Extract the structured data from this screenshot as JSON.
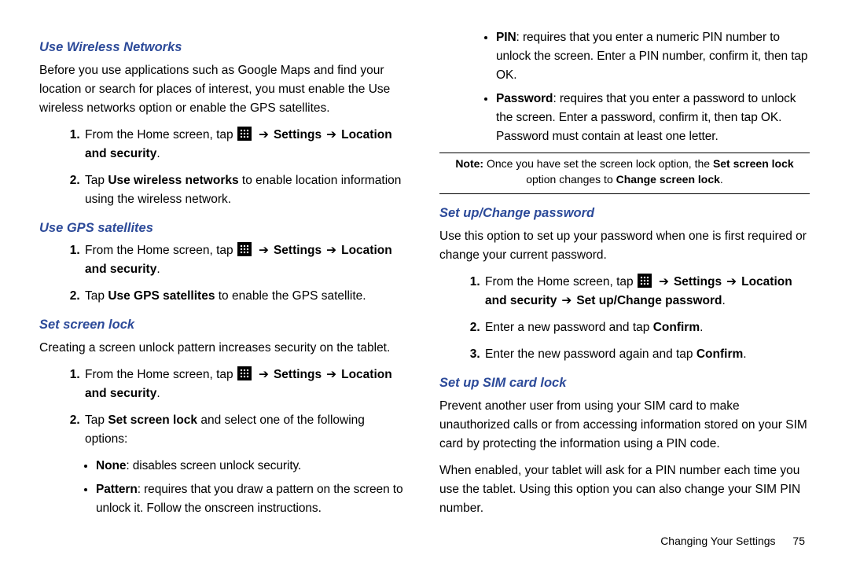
{
  "left": {
    "sec1": {
      "heading": "Use Wireless Networks",
      "intro": "Before you use applications such as Google Maps and find your location or search for places of interest, you must enable the Use wireless networks option or enable the GPS satellites.",
      "step1_a": "From the Home screen, tap ",
      "step1_b": "Settings",
      "step1_c": "Location and security",
      "step1_d": ".",
      "step2_a": "Tap ",
      "step2_b": "Use wireless networks",
      "step2_c": " to enable location information using the wireless network."
    },
    "sec2": {
      "heading": "Use GPS satellites",
      "step1_a": "From the Home screen, tap ",
      "step1_b": "Settings",
      "step1_c": "Location and security",
      "step1_d": ".",
      "step2_a": "Tap ",
      "step2_b": "Use GPS satellites",
      "step2_c": " to enable the GPS satellite."
    },
    "sec3": {
      "heading": "Set screen lock",
      "intro": "Creating a screen unlock pattern increases security on the tablet.",
      "step1_a": "From the Home screen, tap ",
      "step1_b": "Settings",
      "step1_c": "Location and security",
      "step1_d": ".",
      "step2_a": "Tap ",
      "step2_b": "Set screen lock",
      "step2_c": " and select one of the following options:",
      "opt1_a": "None",
      "opt1_b": ": disables screen unlock security.",
      "opt2_a": "Pattern",
      "opt2_b": ": requires that you draw a pattern on the screen to unlock it. Follow the onscreen instructions."
    }
  },
  "right": {
    "opts": {
      "opt3_a": "PIN",
      "opt3_b": ": requires that you enter a numeric PIN number to unlock the screen. Enter a PIN number, confirm it, then tap OK.",
      "opt4_a": "Password",
      "opt4_b": ": requires that you enter a password to unlock the screen. Enter a password, confirm it, then tap OK. Password must contain at least one letter."
    },
    "note_a": "Note:",
    "note_b": " Once you have set the screen lock option, the ",
    "note_c": "Set screen lock",
    "note_d": " option changes to ",
    "note_e": "Change screen lock",
    "note_f": ".",
    "sec4": {
      "heading": "Set up/Change password",
      "intro": "Use this option to set up your password when one is first required or change your current password.",
      "step1_a": "From the Home screen, tap ",
      "step1_b": "Settings",
      "step1_c": "Location and security",
      "step1_d": "Set up/Change password",
      "step1_e": ".",
      "step2_a": "Enter a new password and tap ",
      "step2_b": "Confirm",
      "step2_c": ".",
      "step3_a": "Enter the new password again and tap ",
      "step3_b": "Confirm",
      "step3_c": "."
    },
    "sec5": {
      "heading": "Set up SIM card lock",
      "p1": "Prevent another user from using your SIM card to make unauthorized calls or from accessing information stored on your SIM card by protecting the information using a PIN code.",
      "p2": "When enabled, your tablet will ask for a PIN number each time you use the tablet. Using this option you can also change your SIM PIN number."
    }
  },
  "footer": {
    "title": "Changing Your Settings",
    "page": "75"
  }
}
